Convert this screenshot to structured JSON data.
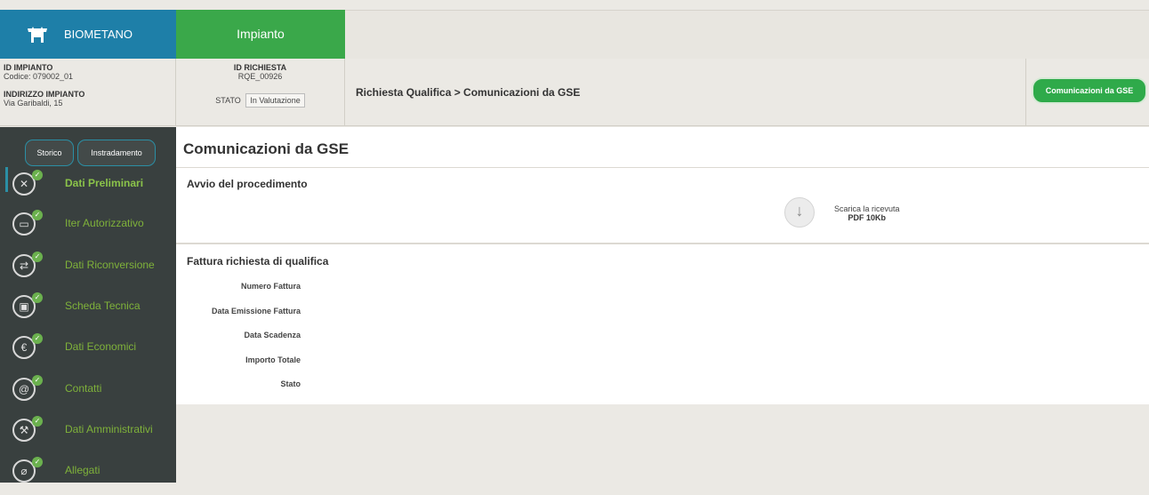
{
  "header": {
    "brand": "BIOMETANO",
    "tab": "Impianto"
  },
  "info": {
    "id_impianto_label": "ID IMPIANTO",
    "codice": "Codice: 079002_01",
    "indirizzo_label": "INDIRIZZO IMPIANTO",
    "indirizzo": "Via Garibaldi, 15",
    "id_richiesta_label": "ID RICHIESTA",
    "id_richiesta": "RQE_00926",
    "stato_label": "STATO",
    "stato_value": "In Valutazione",
    "breadcrumb": "Richiesta Qualifica > Comunicazioni da GSE",
    "gse_button": "Comunicazioni da GSE"
  },
  "sidebar": {
    "buttons": {
      "storico": "Storico",
      "instradamento": "Instradamento"
    },
    "items": [
      {
        "label": "Dati Preliminari",
        "icon": "tools-icon"
      },
      {
        "label": "Iter Autorizzativo",
        "icon": "factory-icon"
      },
      {
        "label": "Dati Riconversione",
        "icon": "shuffle-icon"
      },
      {
        "label": "Scheda Tecnica",
        "icon": "wallet-icon"
      },
      {
        "label": "Dati Economici",
        "icon": "euro-icon"
      },
      {
        "label": "Contatti",
        "icon": "contact-icon"
      },
      {
        "label": "Dati Amministrativi",
        "icon": "wrench-icon"
      },
      {
        "label": "Allegati",
        "icon": "paperclip-icon"
      }
    ]
  },
  "main": {
    "title": "Comunicazioni da GSE",
    "section1": {
      "title": "Avvio del procedimento",
      "download_label": "Scarica la ricevuta",
      "download_file": "PDF 10Kb"
    },
    "section2": {
      "title": "Fattura richiesta di qualifica",
      "fields": [
        "Numero Fattura",
        "Data Emissione Fattura",
        "Data Scadenza",
        "Importo Totale",
        "Stato"
      ]
    }
  },
  "colors": {
    "brand": "#1e7fa8",
    "accent_green": "#3aa84a",
    "sidebar_bg": "#39403f",
    "sidebar_text": "#7fb23a"
  }
}
